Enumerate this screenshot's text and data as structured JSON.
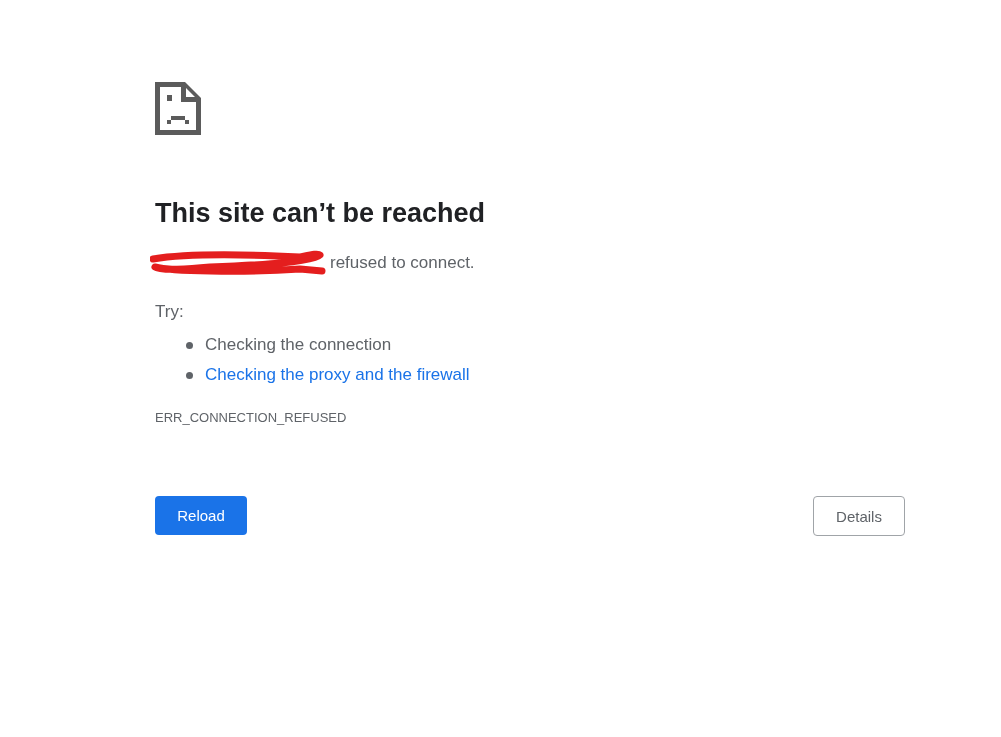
{
  "heading": "This site can’t be reached",
  "message": "refused to connect.",
  "redacted_host": true,
  "try_label": "Try:",
  "suggestions": [
    {
      "kind": "text",
      "label": "Checking the connection"
    },
    {
      "kind": "link",
      "label": "Checking the proxy and the firewall"
    }
  ],
  "error_code": "ERR_CONNECTION_REFUSED",
  "buttons": [
    {
      "kind": "primary",
      "label": "Reload"
    },
    {
      "kind": "secondary",
      "label": "Details"
    }
  ]
}
